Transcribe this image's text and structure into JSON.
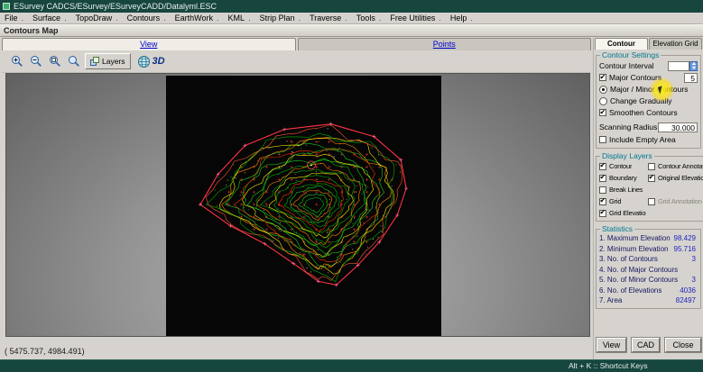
{
  "window": {
    "title": "ESurvey CADCS/ESurvey/ESurveyCADD/Datalyml.ESC"
  },
  "menu": {
    "items": [
      "File",
      "Surface",
      "TopoDraw",
      "Contours",
      "EarthWork",
      "KML",
      "Strip Plan",
      "Traverse",
      "Tools",
      "Free Utilities",
      "Help"
    ]
  },
  "app_window": {
    "title": "Contours Map"
  },
  "tabs": {
    "view": "View",
    "points": "Points"
  },
  "toolbar": {
    "layers_label": "Layers",
    "threed_label": "3D"
  },
  "canvas": {
    "coordinates": "( 5475.737, 4984.491)"
  },
  "right_panel": {
    "tabs": {
      "contour": "Contour",
      "elevation_grid": "Elevation Grid"
    },
    "contour_settings": {
      "title": "Contour Settings",
      "contour_interval_label": "Contour Interval",
      "contour_interval_value": "",
      "major_contours_label": "Major Contours",
      "major_contours_checked": true,
      "major_contours_value": "5",
      "major_minor_label": "Major / Minor Contours",
      "major_minor_selected": true,
      "change_gradually_label": "Change Gradually",
      "change_gradually_selected": false,
      "smoothen_label": "Smoothen Contours",
      "smoothen_checked": true,
      "scanning_radius_label": "Scanning Radius",
      "scanning_radius_value": "30.000",
      "include_empty_label": "Include Empty Area",
      "include_empty_checked": false
    },
    "display_layers": {
      "title": "Display Layers",
      "rows": [
        {
          "left": {
            "label": "Contour",
            "checked": true
          },
          "right": {
            "label": "Contour Annotations",
            "checked": false,
            "disabled": false
          }
        },
        {
          "left": {
            "label": "Boundary",
            "checked": true
          },
          "right": {
            "label": "Original Elevations",
            "checked": true,
            "disabled": false
          }
        },
        {
          "left": {
            "label": "Break Lines",
            "checked": false
          }
        },
        {
          "left": {
            "label": "Grid",
            "checked": true
          },
          "right": {
            "label": "Grid Annotation",
            "checked": false,
            "disabled": true
          }
        },
        {
          "left": {
            "label": "Grid Elevations",
            "checked": true
          }
        }
      ]
    },
    "statistics": {
      "title": "Statistics",
      "rows": [
        {
          "label": "1. Maximum Elevation",
          "value": "98.429"
        },
        {
          "label": "2. Minimum Elevation",
          "value": "95.716"
        },
        {
          "label": "3. No. of Contours",
          "value": "3"
        },
        {
          "label": "4. No. of Major Contours",
          "value": ""
        },
        {
          "label": "5. No. of Minor Contours",
          "value": "3"
        },
        {
          "label": "6. No. of Elevations",
          "value": "4036"
        },
        {
          "label": "7. Area",
          "value": "82497"
        }
      ]
    },
    "buttons": {
      "view": "View",
      "cad": "CAD",
      "close": "Close"
    }
  },
  "statusbar": {
    "shortcut": "Alt + K :: Shortcut Keys"
  }
}
